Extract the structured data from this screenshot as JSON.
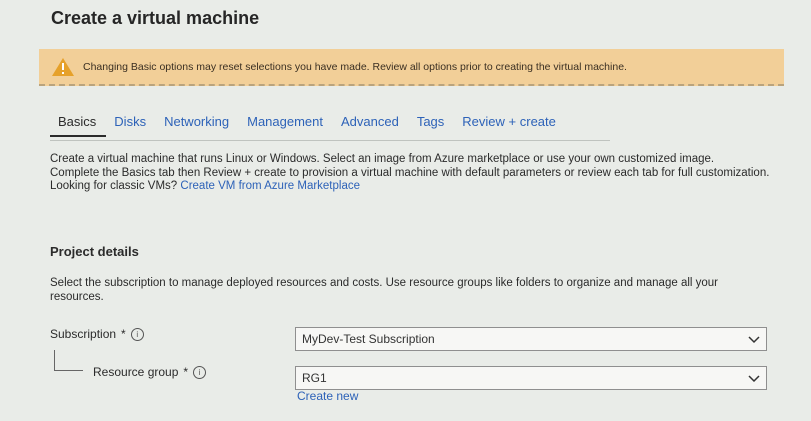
{
  "page": {
    "title": "Create a virtual machine"
  },
  "warning": {
    "icon": "warning-triangle-icon",
    "text": "Changing Basic options may reset selections you have made. Review all options prior to creating the virtual machine."
  },
  "tabs": [
    {
      "label": "Basics",
      "active": true
    },
    {
      "label": "Disks"
    },
    {
      "label": "Networking"
    },
    {
      "label": "Management"
    },
    {
      "label": "Advanced"
    },
    {
      "label": "Tags"
    },
    {
      "label": "Review + create"
    }
  ],
  "intro": {
    "line1": "Create a virtual machine that runs Linux or Windows. Select an image from Azure marketplace or use your own customized image.",
    "line2": "Complete the Basics tab then Review + create to provision a virtual machine with default parameters or review each tab for full customization.",
    "classic_prefix": "Looking for classic VMs?",
    "classic_link": "Create VM from Azure Marketplace"
  },
  "project_details": {
    "title": "Project details",
    "description": "Select the subscription to manage deployed resources and costs. Use resource groups like folders to organize and manage all your resources.",
    "subscription": {
      "label": "Subscription",
      "required": "*",
      "value": "MyDev-Test Subscription"
    },
    "resource_group": {
      "label": "Resource group",
      "required": "*",
      "value": "RG1",
      "create_new": "Create new"
    }
  },
  "colors": {
    "link": "#2d62b8",
    "warning_bg": "#f2cf98",
    "warning_icon": "#e6a12a"
  }
}
